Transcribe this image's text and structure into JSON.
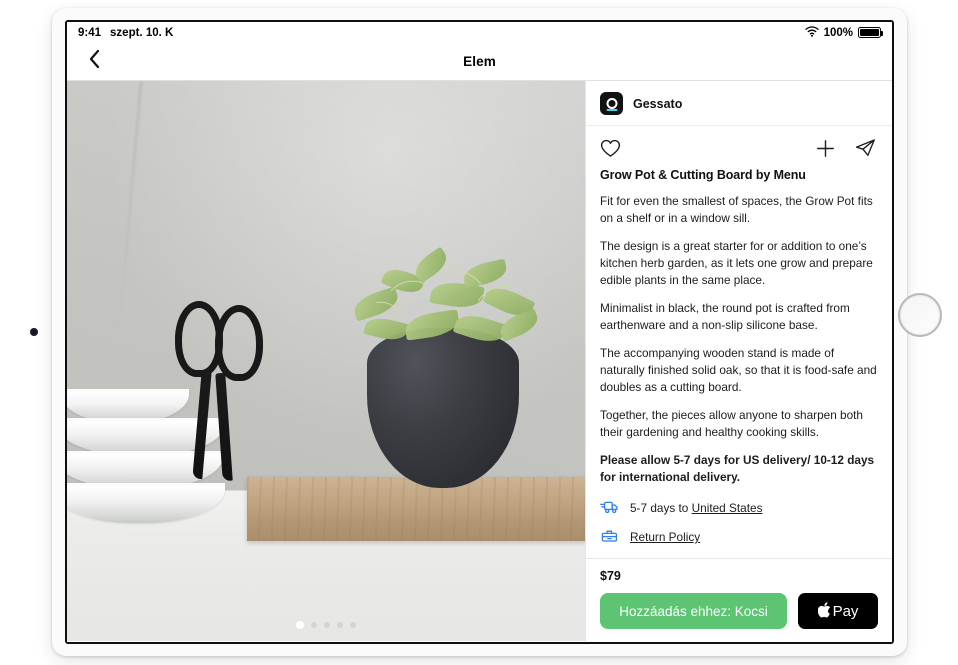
{
  "status_bar": {
    "time": "9:41",
    "date": "szept. 10. K",
    "battery_percent": "100%",
    "wifi_icon": "wifi-icon",
    "battery_icon": "battery-icon"
  },
  "nav": {
    "back_icon": "chevron-left-icon",
    "title": "Elem"
  },
  "gallery": {
    "page_dots_total": 5,
    "active_dot_index": 0,
    "alt": "Grow Pot with greens on an oak cutting board beside stacked bowls and black scissors"
  },
  "merchant": {
    "name": "Gessato",
    "logo_icon": "gessato-logo-icon"
  },
  "actions": {
    "favorite_icon": "heart-icon",
    "add_icon": "plus-icon",
    "share_icon": "share-paper-plane-icon"
  },
  "product": {
    "title": "Grow Pot & Cutting Board by Menu",
    "paragraphs": [
      "Fit for even the smallest of spaces, the Grow Pot fits on a shelf or in a window sill.",
      "The design is a great starter for or addition to one’s kitchen herb garden, as it lets one grow and prepare edible plants in the same place.",
      "Minimalist in black, the round pot is crafted from earthenware and a non-slip silicone base.",
      "The accompanying wooden stand is made of naturally finished solid oak, so that it is food-safe and doubles as a cutting board.",
      "Together, the pieces allow anyone to sharpen both their gardening and healthy cooking skills."
    ],
    "delivery_note": "Please allow 5-7 days for US delivery/ 10-12 days for international delivery."
  },
  "shipping": {
    "delivery_icon": "delivery-truck-icon",
    "delivery_prefix": "5-7 days to ",
    "delivery_destination": "United States",
    "return_icon": "return-box-icon",
    "return_label": "Return Policy",
    "icon_color": "#2f7ff0"
  },
  "purchase": {
    "price": "$79",
    "add_to_cart_label": "Hozzáadás ehhez: Kocsi",
    "add_to_cart_color": "#5cc472",
    "apple_pay_label": "Pay",
    "apple_glyph": "",
    "apple_pay_color": "#000000"
  }
}
